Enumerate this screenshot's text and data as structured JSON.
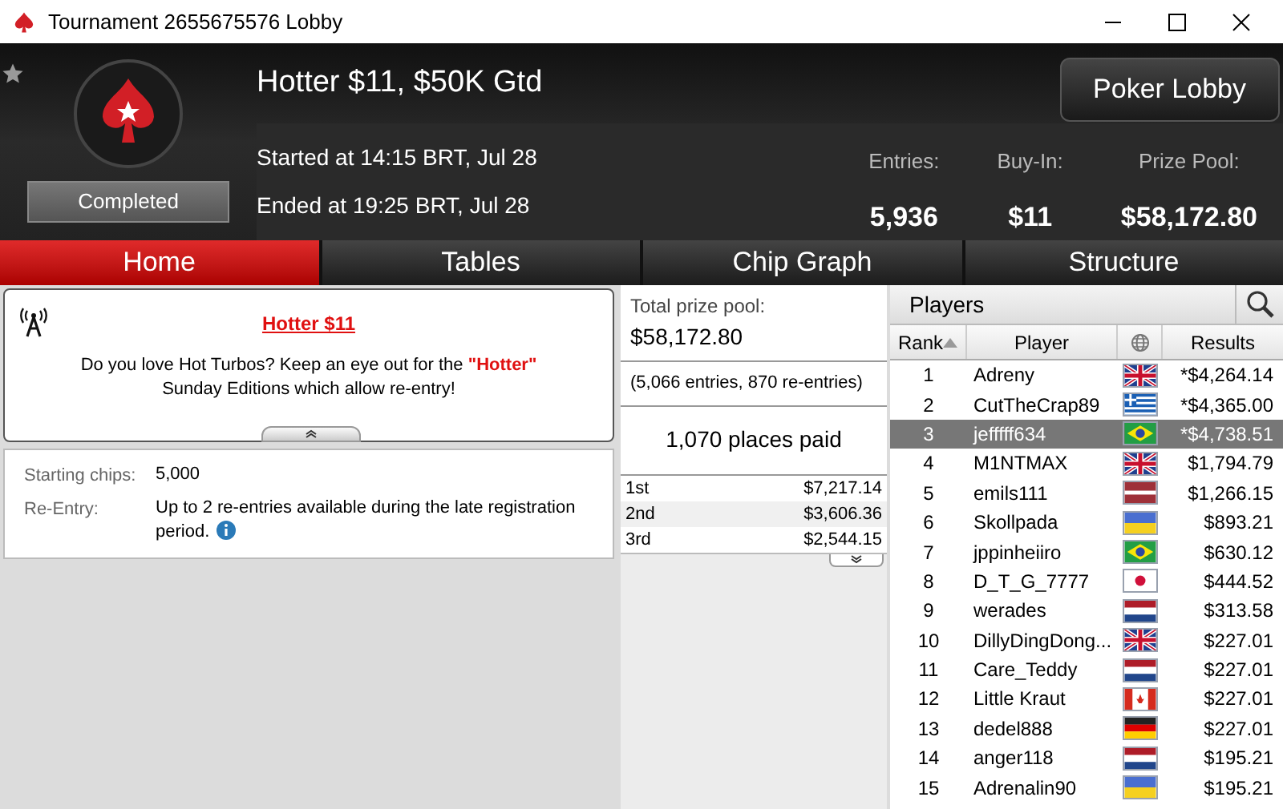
{
  "window": {
    "title": "Tournament 2655675576 Lobby"
  },
  "header": {
    "name": "Hotter $11, $50K Gtd",
    "status": "Completed",
    "started": "Started at 14:15 BRT, Jul 28",
    "ended": "Ended at 19:25 BRT, Jul 28",
    "lobby_button": "Poker Lobby",
    "stats": [
      {
        "label": "Entries:",
        "value": "5,936"
      },
      {
        "label": "Buy-In:",
        "value": "$11"
      },
      {
        "label": "Prize Pool:",
        "value": "$58,172.80"
      }
    ]
  },
  "tabs": [
    {
      "label": "Home",
      "selected": true
    },
    {
      "label": "Tables",
      "selected": false
    },
    {
      "label": "Chip Graph",
      "selected": false
    },
    {
      "label": "Structure",
      "selected": false
    }
  ],
  "news": {
    "title": "Hotter $11",
    "text": "Do you love Hot Turbos? Keep an eye out for the **\"Hotter\"** Sunday Editions which allow re-entry!"
  },
  "details": [
    {
      "label": "Starting chips:",
      "value": "5,000",
      "info": false
    },
    {
      "label": "Re-Entry:",
      "value": "Up to 2 re-entries available during the late registration period.",
      "info": true
    }
  ],
  "prizes": {
    "total_label": "Total prize pool:",
    "total": "$58,172.80",
    "entries": "(5,066 entries, 870 re-entries)",
    "places": "1,070 places paid",
    "rows": [
      {
        "place": "1st",
        "amount": "$7,217.14"
      },
      {
        "place": "2nd",
        "amount": "$3,606.36"
      },
      {
        "place": "3rd",
        "amount": "$2,544.15"
      }
    ]
  },
  "players": {
    "title": "Players",
    "columns": [
      "Rank",
      "Player",
      "Results"
    ],
    "rows": [
      {
        "rank": "1",
        "name": "Adreny",
        "kind": "uk",
        "result": "*$4,264.14",
        "selected": false
      },
      {
        "rank": "2",
        "name": "CutTheCrap89",
        "kind": "gr",
        "result": "*$4,365.00",
        "selected": false
      },
      {
        "rank": "3",
        "name": "jefffff634",
        "kind": "br",
        "result": "*$4,738.51",
        "selected": true
      },
      {
        "rank": "4",
        "name": "M1NTMAX",
        "kind": "uk",
        "result": "$1,794.79",
        "selected": false
      },
      {
        "rank": "5",
        "name": "emils111",
        "kind": "lv",
        "result": "$1,266.15",
        "selected": false
      },
      {
        "rank": "6",
        "name": "Skollpada",
        "kind": "ua",
        "result": "$893.21",
        "selected": false
      },
      {
        "rank": "7",
        "name": "jppinheiiro",
        "kind": "br",
        "result": "$630.12",
        "selected": false
      },
      {
        "rank": "8",
        "name": "D_T_G_7777",
        "kind": "jp",
        "result": "$444.52",
        "selected": false
      },
      {
        "rank": "9",
        "name": "werades",
        "kind": "nl",
        "result": "$313.58",
        "selected": false
      },
      {
        "rank": "10",
        "name": "DillyDingDong...",
        "kind": "uk",
        "result": "$227.01",
        "selected": false
      },
      {
        "rank": "11",
        "name": "Care_Teddy",
        "kind": "nl",
        "result": "$227.01",
        "selected": false
      },
      {
        "rank": "12",
        "name": "Little Kraut",
        "kind": "ca",
        "result": "$227.01",
        "selected": false
      },
      {
        "rank": "13",
        "name": "dedel888",
        "kind": "de",
        "result": "$227.01",
        "selected": false
      },
      {
        "rank": "14",
        "name": "anger118",
        "kind": "nl",
        "result": "$195.21",
        "selected": false
      },
      {
        "rank": "15",
        "name": "Adrenalin90",
        "kind": "ua",
        "result": "$195.21",
        "selected": false
      }
    ]
  }
}
